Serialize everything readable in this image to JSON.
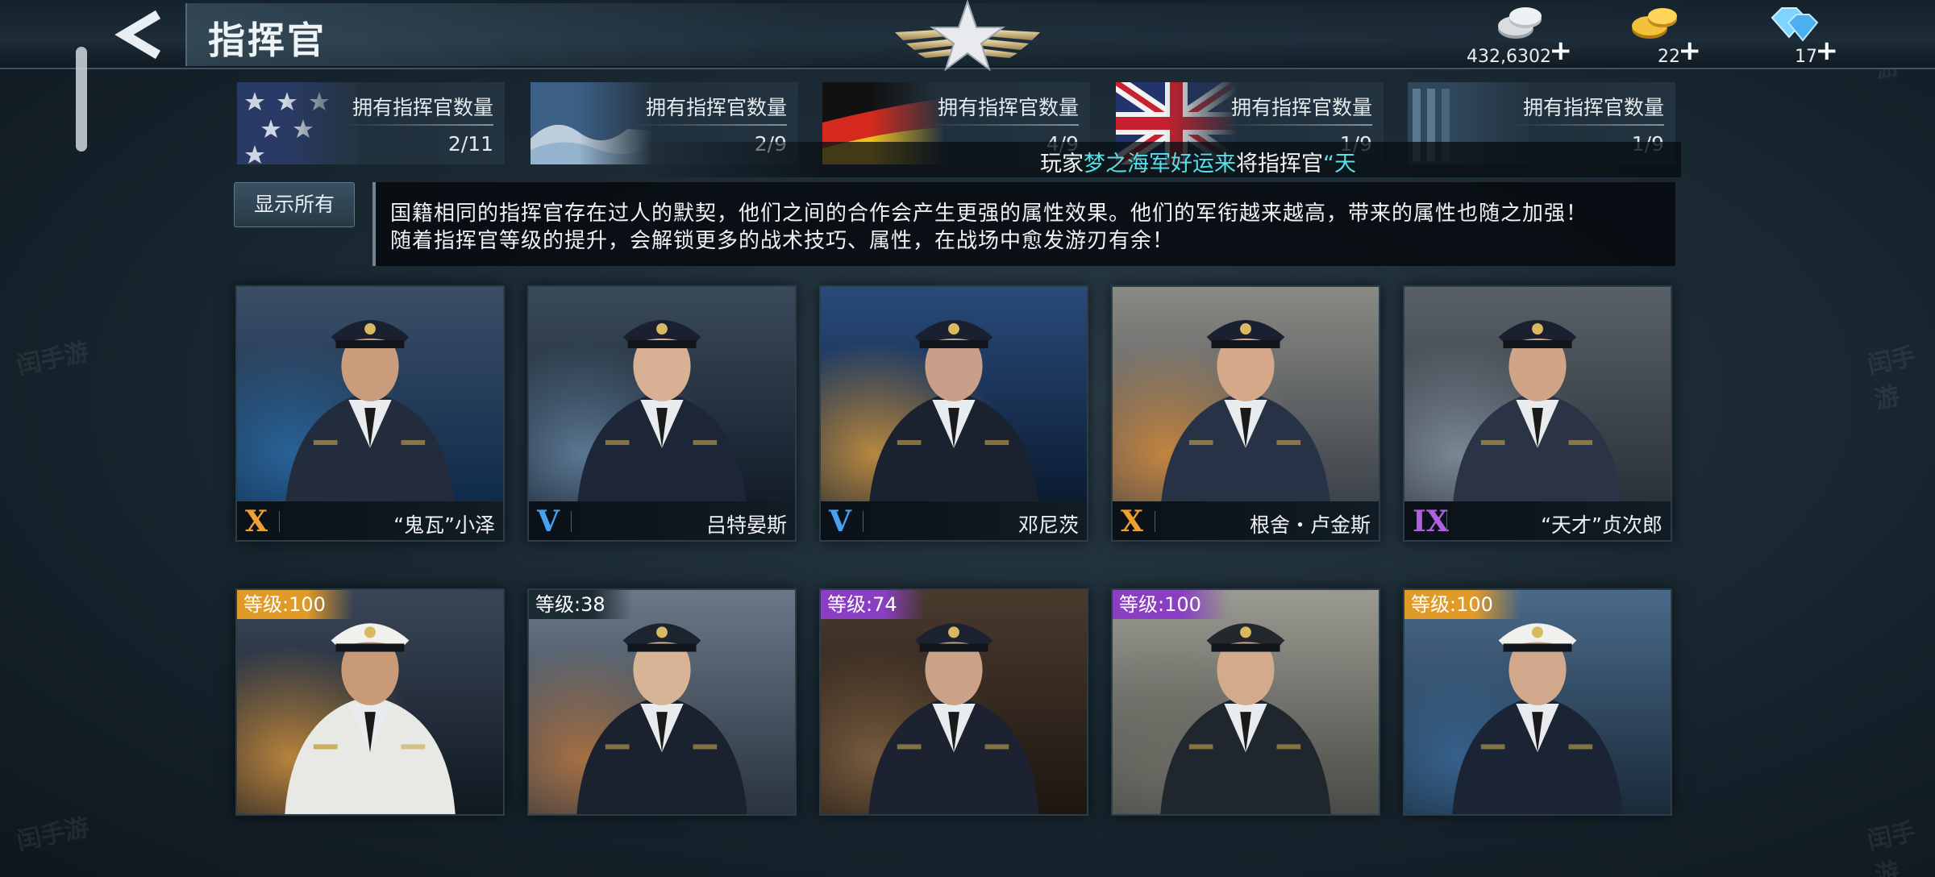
{
  "header": {
    "title": "指挥官",
    "back_icon": "chevron-left-icon",
    "emblem": "star-wings-emblem"
  },
  "currencies": [
    {
      "name": "silver",
      "icon": "silver-coin-icon",
      "value": "432,6302",
      "plus": "+"
    },
    {
      "name": "gold",
      "icon": "gold-coin-icon",
      "value": "22",
      "plus": "+"
    },
    {
      "name": "diamond",
      "icon": "diamond-icon",
      "value": "17",
      "plus": "+"
    }
  ],
  "nation_tabs": [
    {
      "flag": "usa-flag",
      "label": "拥有指挥官数量",
      "count": "2/11"
    },
    {
      "flag": "japan-flag",
      "label": "拥有指挥官数量",
      "count": "2/9"
    },
    {
      "flag": "germany-flag",
      "label": "拥有指挥官数量",
      "count": "4/9"
    },
    {
      "flag": "uk-flag",
      "label": "拥有指挥官数量",
      "count": "1/9"
    },
    {
      "flag": "other-flag",
      "label": "拥有指挥官数量",
      "count": "1/9"
    }
  ],
  "broadcast": {
    "prefix": "玩家",
    "player": "梦之海军好运来",
    "middle": "将指挥官",
    "commander": "“天"
  },
  "show_all_label": "显示所有",
  "description": {
    "line1": "国籍相同的指挥官存在过人的默契，他们之间的合作会产生更强的属性效果。他们的军衔越来越高，带来的属性也随之加强！",
    "line2": "随着指挥官等级的提升，会解锁更多的战术技巧、属性，在战场中愈发游刃有余！"
  },
  "commanders_row1": [
    {
      "rank": "X",
      "rank_color": "#f0a030",
      "name": "“鬼瓦”小泽"
    },
    {
      "rank": "V",
      "rank_color": "#4aa0f0",
      "name": "吕特晏斯"
    },
    {
      "rank": "V",
      "rank_color": "#4aa0f0",
      "name": "邓尼茨"
    },
    {
      "rank": "X",
      "rank_color": "#f0a030",
      "name": "根舍・卢金斯"
    },
    {
      "rank": "IX",
      "rank_color": "#b060e0",
      "name": "“天才”贞次郎"
    }
  ],
  "commanders_row2": [
    {
      "level": "等级:100",
      "badge_color": "#e09a2a"
    },
    {
      "level": "等级:38",
      "badge_color": "#1c2a34"
    },
    {
      "level": "等级:74",
      "badge_color": "#8a3fc2"
    },
    {
      "level": "等级:100",
      "badge_color": "#8a3fc2"
    },
    {
      "level": "等级:100",
      "badge_color": "#e09a2a"
    }
  ],
  "colors": {
    "accent_cyan": "#56e0e8",
    "rank_gold": "#f0a030",
    "rank_blue": "#4aa0f0",
    "rank_purple": "#b060e0"
  }
}
